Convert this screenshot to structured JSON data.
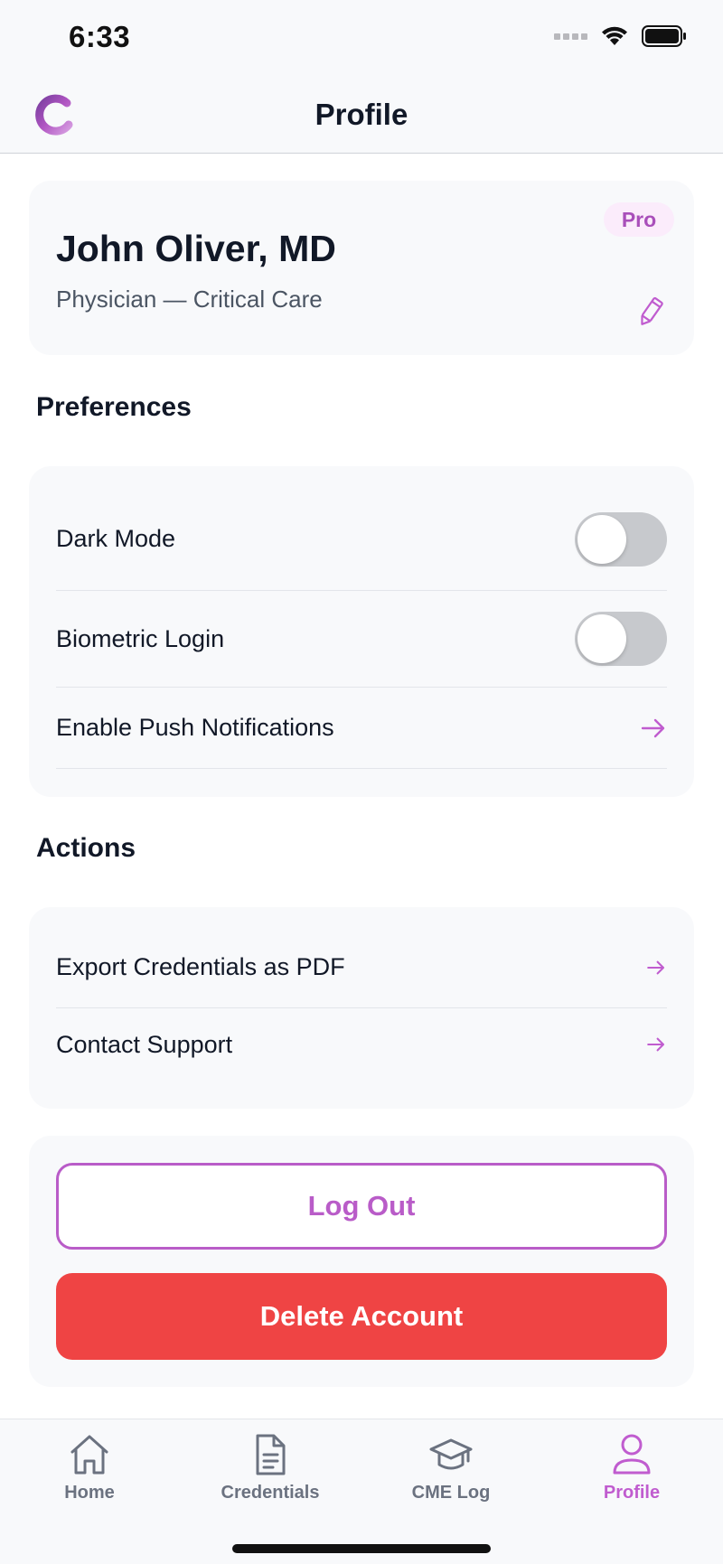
{
  "status_bar": {
    "time": "6:33"
  },
  "nav": {
    "title": "Profile",
    "logo_icon": "app-logo-c"
  },
  "profile": {
    "name": "John Oliver, MD",
    "role": "Physician — Critical Care",
    "badge": "Pro",
    "edit_icon": "pencil-icon"
  },
  "preferences": {
    "title": "Preferences",
    "items": [
      {
        "label": "Dark Mode",
        "control": "toggle",
        "on": false
      },
      {
        "label": "Biometric Login",
        "control": "toggle",
        "on": false
      },
      {
        "label": "Enable Push Notifications",
        "control": "arrow"
      }
    ]
  },
  "actions": {
    "title": "Actions",
    "items": [
      {
        "label": "Export Credentials as PDF"
      },
      {
        "label": "Contact Support"
      }
    ]
  },
  "buttons": {
    "logout": "Log Out",
    "delete": "Delete Account"
  },
  "tabs": [
    {
      "label": "Home",
      "icon": "home-icon",
      "active": false
    },
    {
      "label": "Credentials",
      "icon": "document-icon",
      "active": false
    },
    {
      "label": "CME Log",
      "icon": "graduation-cap-icon",
      "active": false
    },
    {
      "label": "Profile",
      "icon": "user-icon",
      "active": true
    }
  ],
  "colors": {
    "accent": "#c05ccf",
    "danger": "#ef4444",
    "badge_bg": "#fbecfb",
    "toggle_off": "#c7c9cd"
  }
}
